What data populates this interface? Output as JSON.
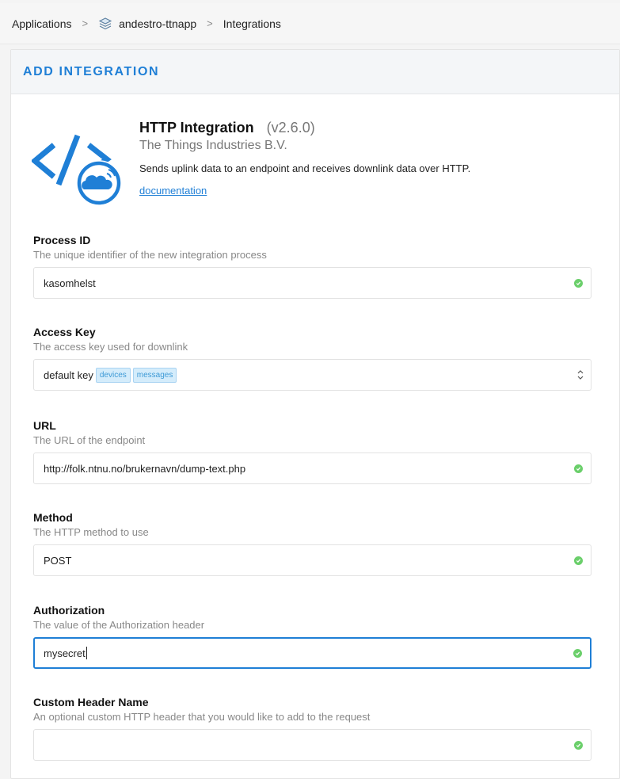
{
  "breadcrumb": {
    "applications": "Applications",
    "app": "andestro-ttnapp",
    "integrations": "Integrations",
    "separator": ">"
  },
  "page": {
    "title": "ADD INTEGRATION"
  },
  "integration": {
    "name": "HTTP Integration",
    "version": "(v2.6.0)",
    "vendor": "The Things Industries B.V.",
    "description": "Sends uplink data to an endpoint and receives downlink data over HTTP.",
    "doc_link": "documentation"
  },
  "fields": {
    "process_id": {
      "label": "Process ID",
      "help": "The unique identifier of the new integration process",
      "value": "kasomhelst"
    },
    "access_key": {
      "label": "Access Key",
      "help": "The access key used for downlink",
      "value": "default key",
      "tags": [
        "devices",
        "messages"
      ]
    },
    "url": {
      "label": "URL",
      "help": "The URL of the endpoint",
      "value": "http://folk.ntnu.no/brukernavn/dump-text.php"
    },
    "method": {
      "label": "Method",
      "help": "The HTTP method to use",
      "value": "POST"
    },
    "authorization": {
      "label": "Authorization",
      "help": "The value of the Authorization header",
      "value": "mysecret"
    },
    "custom_header_name": {
      "label": "Custom Header Name",
      "help": "An optional custom HTTP header that you would like to add to the request",
      "value": ""
    }
  },
  "colors": {
    "accent": "#1f7fd6",
    "valid": "#6bcf6b",
    "tag_bg": "#d4ecfb"
  }
}
